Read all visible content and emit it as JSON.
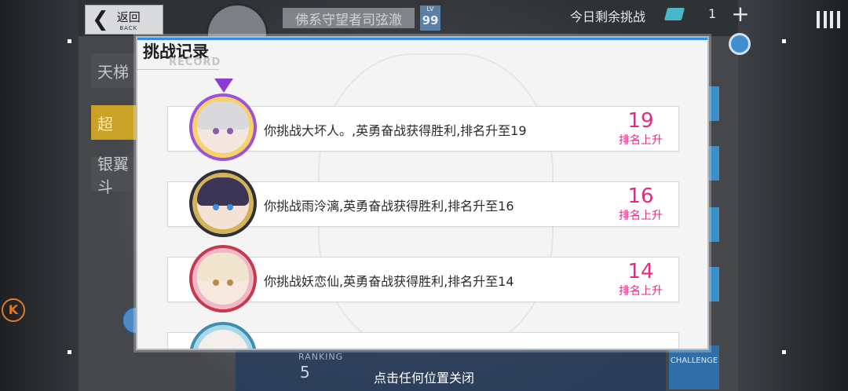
{
  "header": {
    "back_label": "返回",
    "back_sub": "BACK",
    "player_name": "佛系守望者司弦澈",
    "level_prefix": "LV",
    "level": "99",
    "remaining_label": "今日剩余挑战",
    "remaining_count": "1",
    "plus": "+"
  },
  "left_tabs": [
    {
      "label": "天梯"
    },
    {
      "label": "超"
    },
    {
      "label": "银翼斗"
    }
  ],
  "k_icon": "K",
  "bottom": {
    "ranking_label": "RANKING",
    "ranking_value": "5",
    "challenge_label": "CHALLENGE",
    "close_hint": "点击任何位置关闭"
  },
  "modal": {
    "title": "挑战记录",
    "subtitle": "RECORD",
    "records": [
      {
        "text": "你挑战大坏人。,英勇奋战获得胜利,排名升至19",
        "rank": "19",
        "rank_label": "排名上升"
      },
      {
        "text": "你挑战雨泠漓,英勇奋战获得胜利,排名升至16",
        "rank": "16",
        "rank_label": "排名上升"
      },
      {
        "text": "你挑战妖恋仙,英勇奋战获得胜利,排名升至14",
        "rank": "14",
        "rank_label": "排名上升"
      },
      {
        "text": "",
        "rank": "",
        "rank_label": ""
      }
    ]
  },
  "colors": {
    "accent_blue": "#2f8ee8",
    "rank_pink": "#e6297e",
    "active_tab": "#c9a227"
  },
  "icons": [
    "back-arrow-icon",
    "ticket-icon",
    "plus-icon",
    "menu-icon",
    "gear-icon",
    "k-icon",
    "crown-icon"
  ]
}
